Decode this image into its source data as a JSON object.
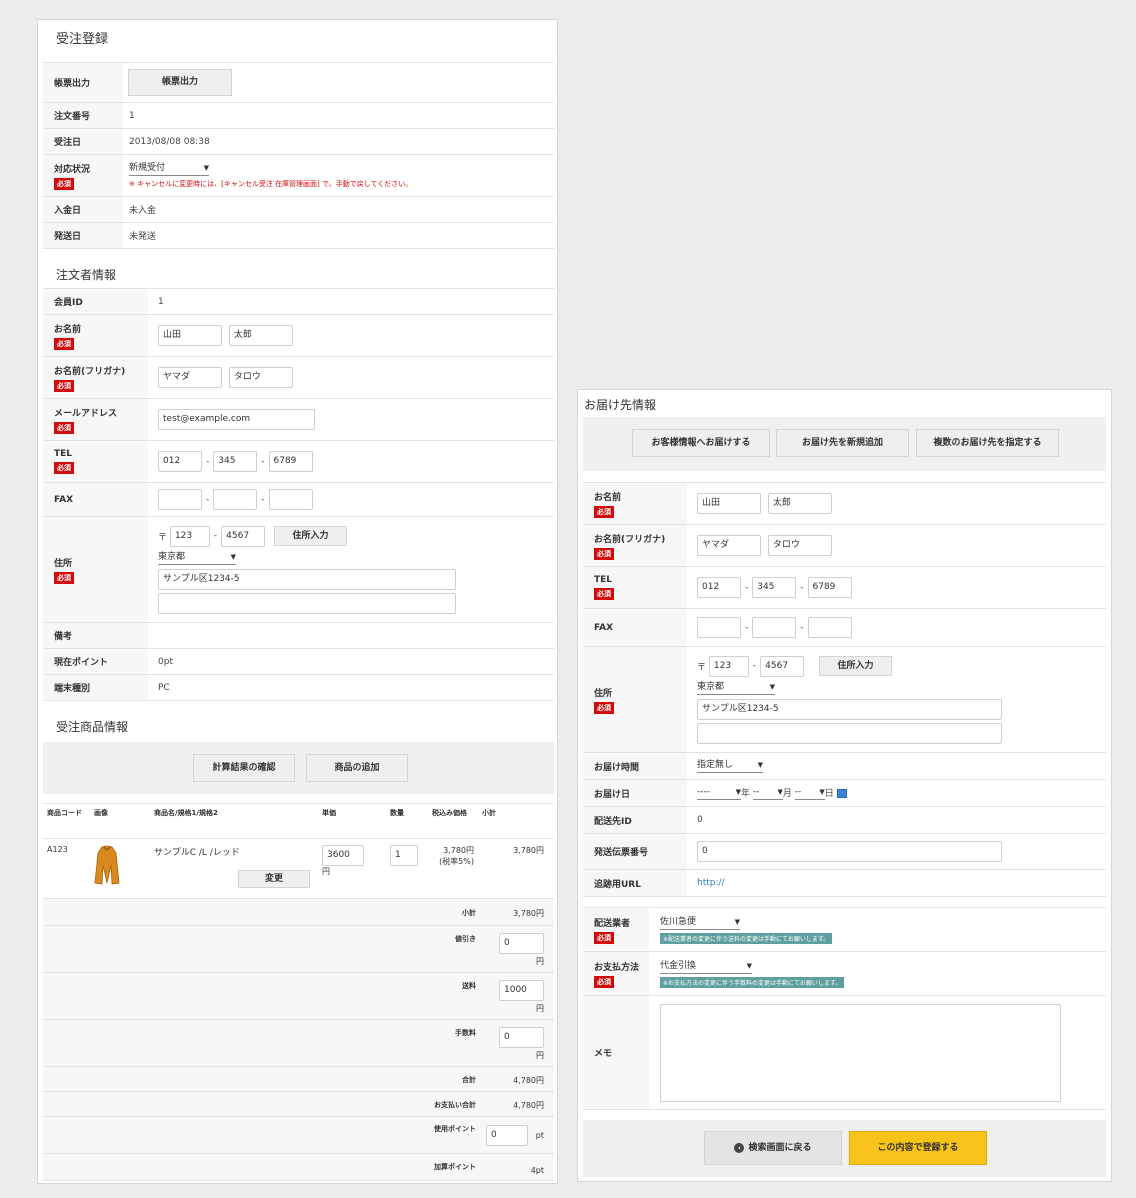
{
  "order": {
    "title": "受注登録",
    "rows": {
      "print_label": "帳票出力",
      "print_button": "帳票出力",
      "order_no_label": "注文番号",
      "order_no": "1",
      "order_date_label": "受注日",
      "order_date": "2013/08/08 08:38",
      "status_label": "対応状況",
      "status_value": "新規受付",
      "status_note": "※ キャンセルに変更時には、[キャンセル受注 在庫管理画面] で、手動で戻してください。",
      "payment_date_label": "入金日",
      "payment_date": "未入金",
      "ship_date_label": "発送日",
      "ship_date": "未発送"
    }
  },
  "required": "必須",
  "customer": {
    "title": "注文者情報",
    "member_id_label": "会員ID",
    "member_id": "1",
    "name_label": "お名前",
    "last_name": "山田",
    "first_name": "太郎",
    "kana_label": "お名前(フリガナ)",
    "last_kana": "ヤマダ",
    "first_kana": "タロウ",
    "email_label": "メールアドレス",
    "email": "test@example.com",
    "tel_label": "TEL",
    "tel1": "012",
    "tel2": "345",
    "tel3": "6789",
    "fax_label": "FAX",
    "address_label": "住所",
    "zip_mark": "〒",
    "zip1": "123",
    "zip2": "4567",
    "zip_button": "住所入力",
    "pref": "東京都",
    "addr1": "サンプル区1234-5",
    "addr2": "",
    "remarks_label": "備考",
    "points_label": "現在ポイント",
    "points": "0pt",
    "device_label": "端末種別",
    "device": "PC"
  },
  "products": {
    "title": "受注商品情報",
    "calc_button": "計算結果の確認",
    "add_button": "商品の追加",
    "headers": [
      "商品コード",
      "画像",
      "商品名/規格1/規格2",
      "単価",
      "数量",
      "税込み価格",
      "小計"
    ],
    "item": {
      "code": "A123",
      "name": "サンプルC /L /レッド",
      "change_button": "変更",
      "price": "3600",
      "yen": "円",
      "qty": "1",
      "taxed_price": "3,780円",
      "tax_note": "(税率5%)",
      "subtotal": "3,780円"
    },
    "summary": {
      "subtotal_label": "小計",
      "subtotal": "3,780円",
      "discount_label": "値引き",
      "discount": "0",
      "shipping_label": "送料",
      "shipping": "1000",
      "fee_label": "手数料",
      "fee": "0",
      "yen": "円",
      "total_label": "合計",
      "total": "4,780円",
      "payment_total_label": "お支払い合計",
      "payment_total": "4,780円",
      "use_points_label": "使用ポイント",
      "use_points": "0",
      "pt": "pt",
      "add_points_label": "加算ポイント",
      "add_points": "4pt"
    }
  },
  "delivery": {
    "title": "お届け先情報",
    "btn_copy": "お客様情報へお届けする",
    "btn_new": "お届け先を新規追加",
    "btn_multi": "複数のお届け先を指定する",
    "name_label": "お名前",
    "last_name": "山田",
    "first_name": "太郎",
    "kana_label": "お名前(フリガナ)",
    "last_kana": "ヤマダ",
    "first_kana": "タロウ",
    "tel_label": "TEL",
    "tel1": "012",
    "tel2": "345",
    "tel3": "6789",
    "fax_label": "FAX",
    "address_label": "住所",
    "zip_mark": "〒",
    "zip1": "123",
    "zip2": "4567",
    "zip_button": "住所入力",
    "pref": "東京都",
    "addr1": "サンプル区1234-5",
    "addr2": "",
    "time_label": "お届け時間",
    "time_value": "指定無し",
    "date_label": "お届け日",
    "date_year": "----",
    "year_unit": "年",
    "date_month": "--",
    "month_unit": "月",
    "date_day": "--",
    "day_unit": "日",
    "dest_id_label": "配送先ID",
    "dest_id": "0",
    "tracking_label": "発送伝票番号",
    "tracking": "0",
    "url_label": "追跡用URL",
    "url": "http://",
    "carrier_label": "配送業者",
    "carrier": "佐川急便",
    "carrier_note": "※配送業者の変更に伴う送料の変更は手動にてお願いします。",
    "pay_label": "お支払方法",
    "pay_value": "代金引換",
    "pay_note": "※お支払方法の変更に伴う手数料の変更は手動にてお願いします。",
    "memo_label": "メモ",
    "memo": "",
    "back_button": "検索画面に戻る",
    "submit_button": "この内容で登録する",
    "colors": {
      "submit": "#f7c31b",
      "required": "#d10b0b",
      "note": "#5f9f9f"
    }
  }
}
